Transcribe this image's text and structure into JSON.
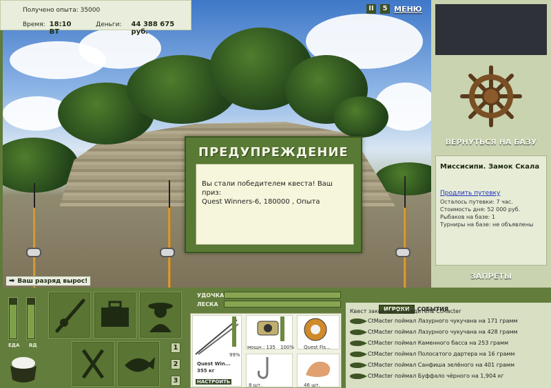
{
  "info": {
    "exp_gained": "Получено опыта: 35000",
    "time_label": "Время:",
    "time_value": "18:10 ВТ",
    "money_label": "Деньги:",
    "money_value": "44 388 675 руб."
  },
  "top_controls": {
    "pause": "II",
    "sound": "5",
    "menu": "МЕНЮ"
  },
  "rank_message": "Ваш разряд вырос!",
  "dialog": {
    "title": "ПРЕДУПРЕЖДЕНИЕ",
    "line1": "Вы стали победителем квеста! Ваш приз:",
    "line2": "Quest Winners-6, 180000 , Опыта"
  },
  "right": {
    "return_to_base": "ВЕРНУТЬСЯ НА БАЗУ",
    "location_title": "Миссисипи. Замок Скала",
    "extend_pass": "Продлить путевку",
    "pass_left": "Осталось путевки: 7 час.",
    "day_cost": "Стоимость дня: 52 000 руб.",
    "fishers_on_base": "Рыбаков на базе: 1",
    "tournaments": "Турниры на базе: не объявлены",
    "bans": "ЗАПРЕТЫ"
  },
  "bottom": {
    "meters": {
      "food_label": "ЕДА",
      "vd_label": "ВД",
      "food_level": 0.85,
      "vd_level": 0.85
    },
    "page_numbers": [
      "1",
      "2",
      "3"
    ],
    "rod_label": "УДОЧКА",
    "line_label": "ЛЕСКА",
    "rod_strength": 1.0,
    "line_strength": 1.0,
    "tackle": {
      "rod_name": "Quest Win...",
      "rod_weight": "355 кг",
      "setup_button": "НАСТРОИТЬ",
      "rod_pct": "99%",
      "reel_caption": "мощн.: 135",
      "reel_pct": "100%",
      "line_caption": "Quest Fis...",
      "hook_caption": "8 шт.",
      "bait_caption": "46 шт."
    }
  },
  "events": {
    "tab_players": "ИГРОКИ",
    "tab_events": "СОБЫТИЯ",
    "header": "Квест закончен! Победитель CtMacter",
    "rows": [
      "CtMacter поймал Лазурного чукучана на 171 грамм",
      "CtMacter поймал Лазурного чукучана на 428 грамм",
      "CtMacter поймал Каменного басса на 253 грамм",
      "CtMacter поймал Полосатого дартера на 16 грамм",
      "CtMacter поймал Санфиша зелёного на 401 грамм",
      "CtMacter поймал Буффало чёрного на 1,904 кг"
    ]
  }
}
